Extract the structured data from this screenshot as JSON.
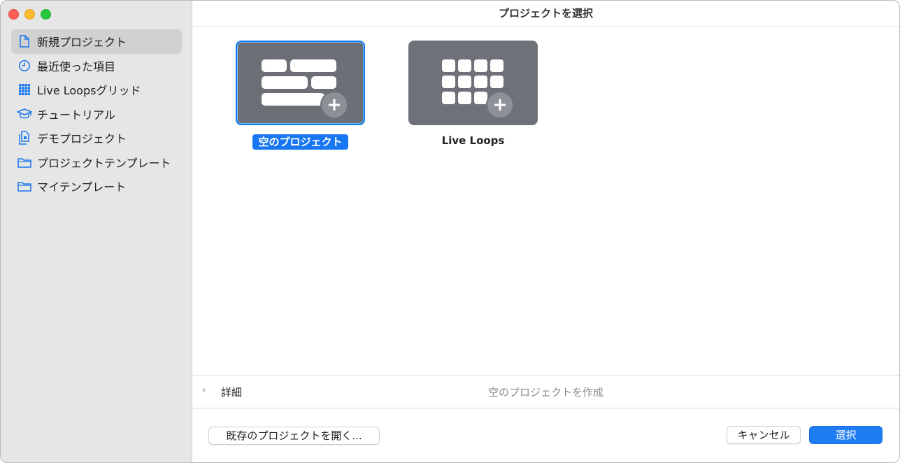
{
  "window": {
    "title": "プロジェクトを選択"
  },
  "sidebar": {
    "items": [
      {
        "label": "新規プロジェクト",
        "icon": "document-icon",
        "selected": true
      },
      {
        "label": "最近使った項目",
        "icon": "clock-icon",
        "selected": false
      },
      {
        "label": "Live Loopsグリッド",
        "icon": "grid-icon",
        "selected": false
      },
      {
        "label": "チュートリアル",
        "icon": "graduation-cap-icon",
        "selected": false
      },
      {
        "label": "デモプロジェクト",
        "icon": "documents-icon",
        "selected": false
      },
      {
        "label": "プロジェクトテンプレート",
        "icon": "folder-icon",
        "selected": false
      },
      {
        "label": "マイテンプレート",
        "icon": "folder-icon",
        "selected": false
      }
    ]
  },
  "tiles": [
    {
      "label": "空のプロジェクト",
      "selected": true,
      "icon": "tracks-plus-icon"
    },
    {
      "label": "Live Loops",
      "selected": false,
      "icon": "grid-plus-icon"
    }
  ],
  "details": {
    "label": "詳細",
    "description": "空のプロジェクトを作成"
  },
  "footer": {
    "open_existing": "既存のプロジェクトを開く...",
    "cancel": "キャンセル",
    "select": "選択"
  },
  "colors": {
    "accent": "#1f7df3",
    "sidebar_bg": "#e6e6e6",
    "tile_bg": "#6e7178"
  }
}
